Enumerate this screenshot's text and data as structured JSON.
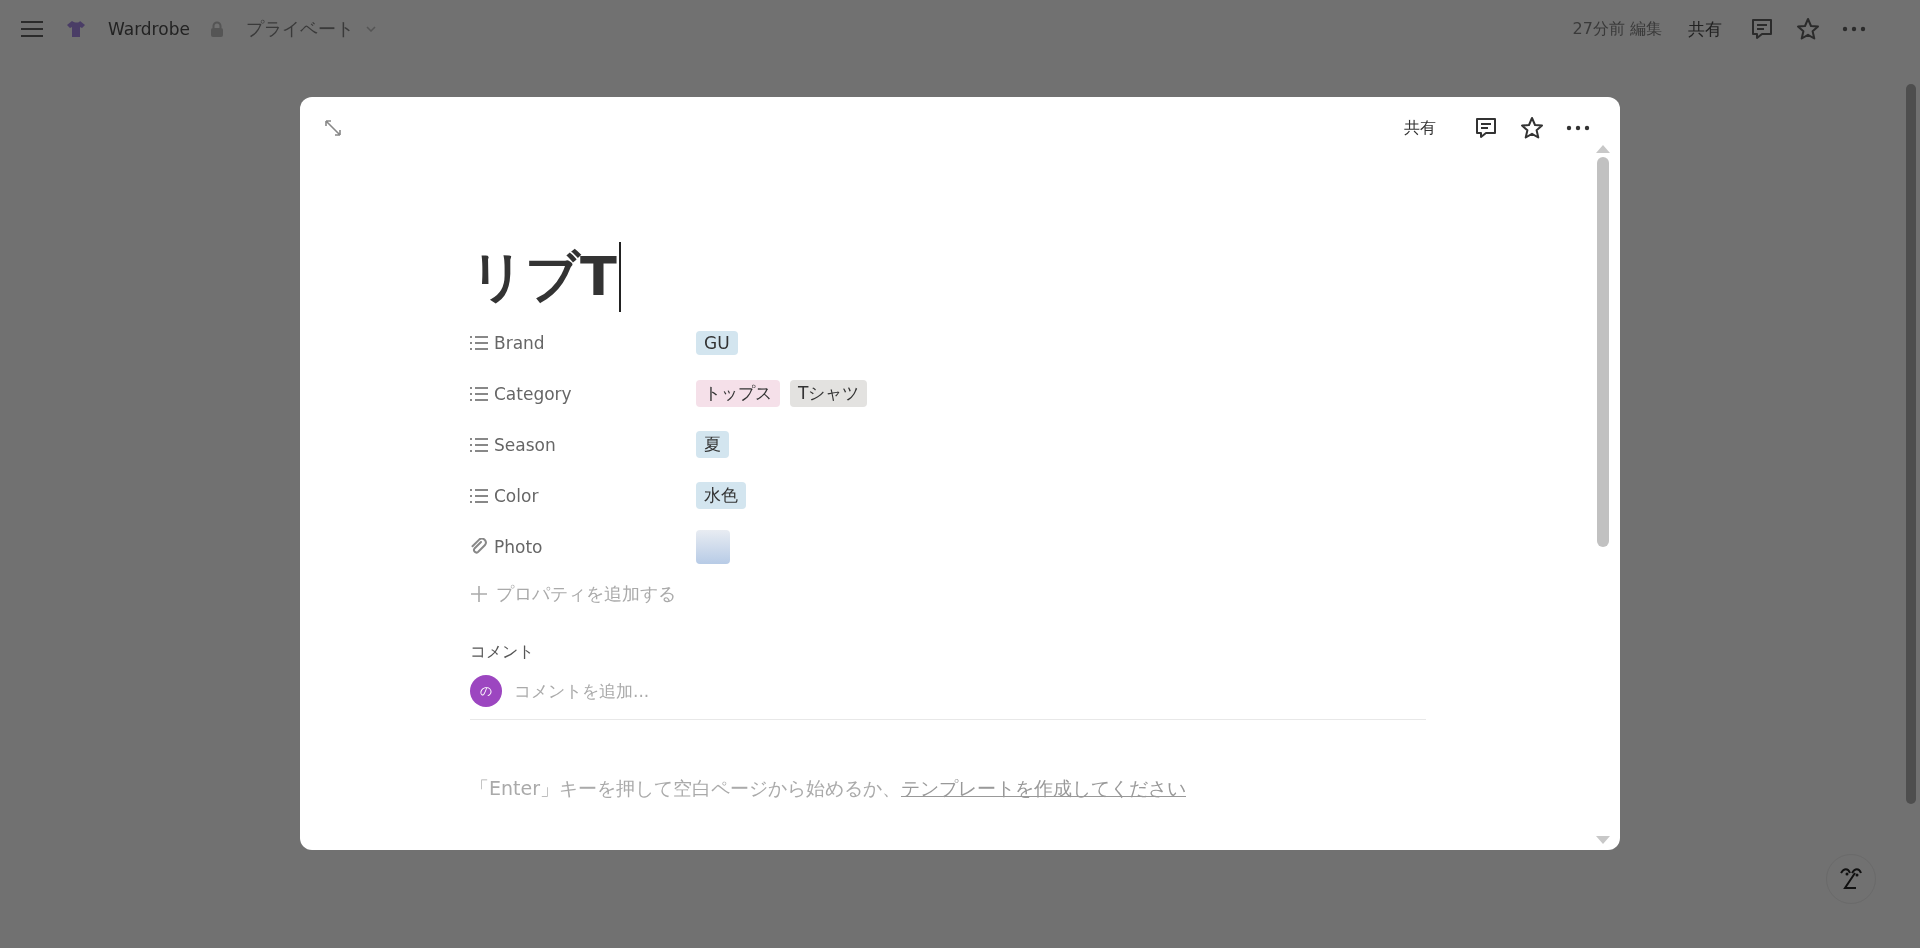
{
  "topbar": {
    "workspace": "Wardrobe",
    "privacy": "プライベート",
    "edited": "27分前 編集",
    "share": "共有"
  },
  "modal": {
    "share": "共有",
    "title": "リブT",
    "properties": [
      {
        "kind": "select",
        "name": "Brand",
        "tags": [
          {
            "label": "GU",
            "color": "#d3e5ef"
          }
        ]
      },
      {
        "kind": "select",
        "name": "Category",
        "tags": [
          {
            "label": "トップス",
            "color": "#f5e0e9"
          },
          {
            "label": "Tシャツ",
            "color": "#e3e2e0"
          }
        ]
      },
      {
        "kind": "select",
        "name": "Season",
        "tags": [
          {
            "label": "夏",
            "color": "#d3e5ef"
          }
        ]
      },
      {
        "kind": "select",
        "name": "Color",
        "tags": [
          {
            "label": "水色",
            "color": "#d3e5ef"
          }
        ]
      },
      {
        "kind": "file",
        "name": "Photo"
      }
    ],
    "add_property": "プロパティを追加する",
    "comments": {
      "heading": "コメント",
      "avatar": "の",
      "placeholder": "コメントを追加..."
    },
    "empty_hint": {
      "text": "「Enter」キーを押して空白ページから始めるか、",
      "link": "テンプレートを作成してください"
    }
  }
}
